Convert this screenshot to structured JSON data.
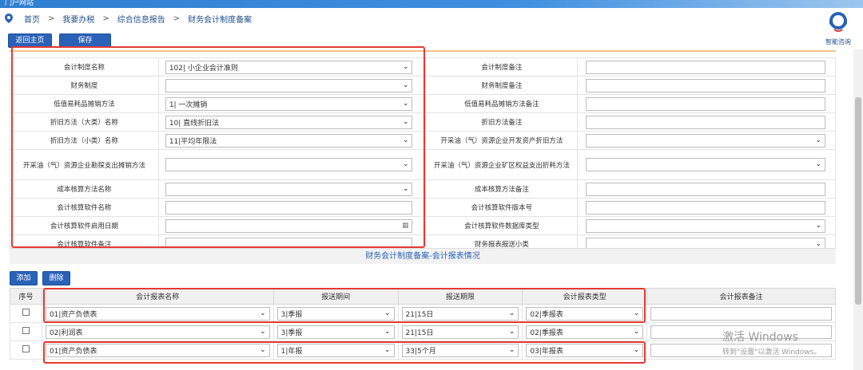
{
  "header": {
    "brand": "门户网站"
  },
  "breadcrumb": [
    "首页",
    "我要办税",
    "综合信息报告",
    "财务会计制度备案"
  ],
  "assistant": {
    "label": "智能咨询"
  },
  "toolbar": {
    "back_label": "返回主页",
    "save_label": "保存"
  },
  "form": {
    "rows": [
      {
        "left_label": "会计制度名称",
        "left_value": "102| 小企业会计准则",
        "left_type": "select",
        "right_label": "会计制度备注",
        "right_value": "",
        "right_type": "input"
      },
      {
        "left_label": "财务制度",
        "left_value": "",
        "left_type": "select",
        "right_label": "财务制度备注",
        "right_value": "",
        "right_type": "input"
      },
      {
        "left_label": "低值易耗品摊销方法",
        "left_value": "1| 一次摊销",
        "left_type": "select",
        "right_label": "低值易耗品摊销方法备注",
        "right_value": "",
        "right_type": "input"
      },
      {
        "left_label": "折旧方法（大类）名称",
        "left_value": "10| 直线折旧法",
        "left_type": "select",
        "right_label": "折旧方法备注",
        "right_value": "",
        "right_type": "input"
      },
      {
        "left_label": "折旧方法（小类）名称",
        "left_value": "11|平均年限法",
        "left_type": "select",
        "right_label": "开采油（气）资源企业开发资产折旧方法",
        "right_value": "",
        "right_type": "select"
      },
      {
        "left_label": "开采油（气）资源企业勘探支出摊销方法",
        "left_value": "",
        "left_type": "select",
        "right_label": "开采油（气）资源企业矿区权益支出折耗方法",
        "right_value": "",
        "right_type": "select"
      },
      {
        "left_label": "成本核算方法名称",
        "left_value": "",
        "left_type": "select",
        "right_label": "成本核算方法备注",
        "right_value": "",
        "right_type": "input"
      },
      {
        "left_label": "会计核算软件名称",
        "left_value": "",
        "left_type": "input",
        "right_label": "会计核算软件版本号",
        "right_value": "",
        "right_type": "input"
      },
      {
        "left_label": "会计核算软件启用日期",
        "left_value": "",
        "left_type": "date",
        "right_label": "会计核算软件数据库类型",
        "right_value": "",
        "right_type": "select"
      },
      {
        "left_label": "会计核算软件备注",
        "left_value": "",
        "left_type": "input",
        "right_label": "财务报表报送小类",
        "right_value": "",
        "right_type": "select"
      }
    ]
  },
  "section": {
    "title": "财务会计制度备案-会计报表情况",
    "add_label": "添加",
    "delete_label": "删除"
  },
  "grid": {
    "headers": [
      "序号",
      "会计报表名称",
      "报送期间",
      "报送期限",
      "会计报表类型",
      "会计报表备注"
    ],
    "rows": [
      {
        "name": "01|资产负债表",
        "period": "3|季报",
        "deadline": "21|15日",
        "type": "02|季报表",
        "remark": ""
      },
      {
        "name": "02|利润表",
        "period": "3|季报",
        "deadline": "21|15日",
        "type": "02|季报表",
        "remark": ""
      },
      {
        "name": "01|资产负债表",
        "period": "1|年报",
        "deadline": "33|5个月",
        "type": "03|年报表",
        "remark": ""
      }
    ]
  },
  "watermark": {
    "line1": "激活 Windows",
    "line2": "转到\"设置\"以激活 Windows。"
  },
  "colors": {
    "primary": "#2a62b8",
    "highlight": "#e53935",
    "header_bar": "#2f7fd0"
  }
}
